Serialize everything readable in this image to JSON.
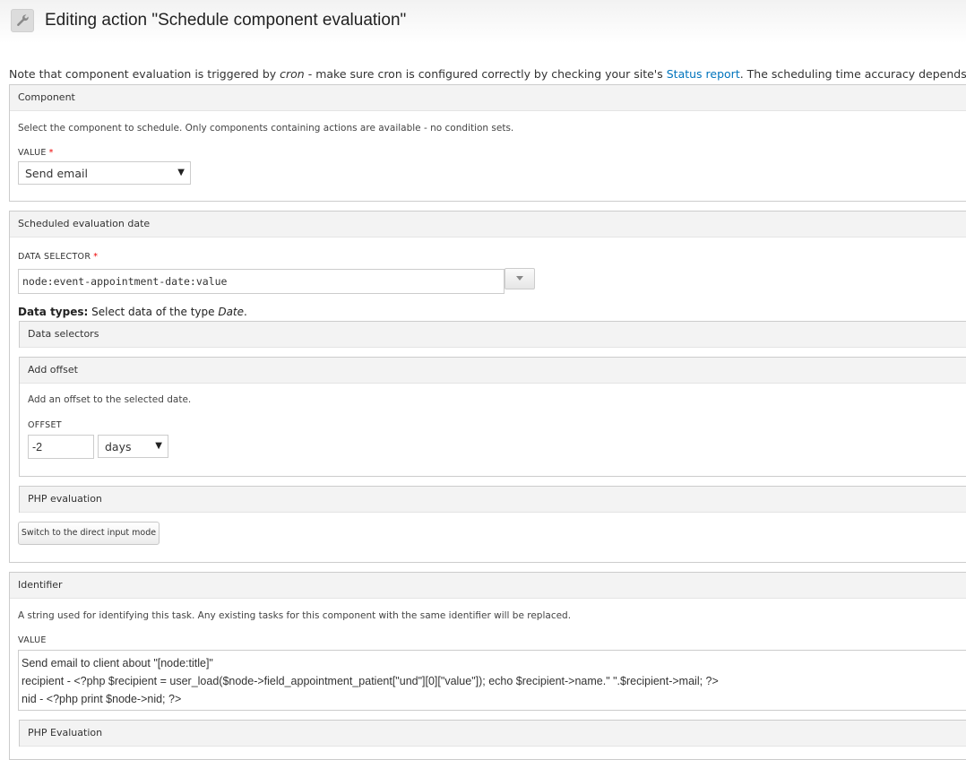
{
  "header": {
    "icon": "wrench-icon",
    "title": "Editing action \"Schedule component evaluation\""
  },
  "note": {
    "text_before": "Note that component evaluation is triggered by ",
    "emphasis": "cron",
    "text_middle": " - make sure cron is configured correctly by checking your site's ",
    "link": "Status report",
    "text_after": ". The scheduling time accuracy depends on your configuration of cron."
  },
  "component": {
    "legend": "Component",
    "description": "Select the component to schedule. Only components containing actions are available - no condition sets.",
    "value_label": "VALUE",
    "required_mark": "*",
    "selected": "Send email"
  },
  "date": {
    "legend": "Scheduled evaluation date",
    "selector_label": "DATA SELECTOR",
    "required_mark": "*",
    "selector_value": "node:event-appointment-date:value",
    "data_types_label": "Data types:",
    "data_types_text": " Select data of the type ",
    "data_types_em": "Date",
    "data_types_end": ".",
    "data_selectors_legend": "Data selectors",
    "offset": {
      "legend": "Add offset",
      "description": "Add an offset to the selected date.",
      "label": "OFFSET",
      "value": "-2",
      "unit": "days"
    },
    "php_legend": "PHP evaluation",
    "switch_button": "Switch to the direct input mode"
  },
  "identifier": {
    "legend": "Identifier",
    "description": "A string used for identifying this task. Any existing tasks for this component with the same identifier will be replaced.",
    "value_label": "VALUE",
    "lines": [
      "Send email to client about \"[node:title]\"",
      "recipient - <?php $recipient = user_load($node->field_appointment_patient[\"und\"][0][\"value\"]); echo $recipient->name.\" \".$recipient->mail;  ?>",
      "nid - <?php print $node->nid; ?>"
    ],
    "php_legend": "PHP Evaluation"
  }
}
